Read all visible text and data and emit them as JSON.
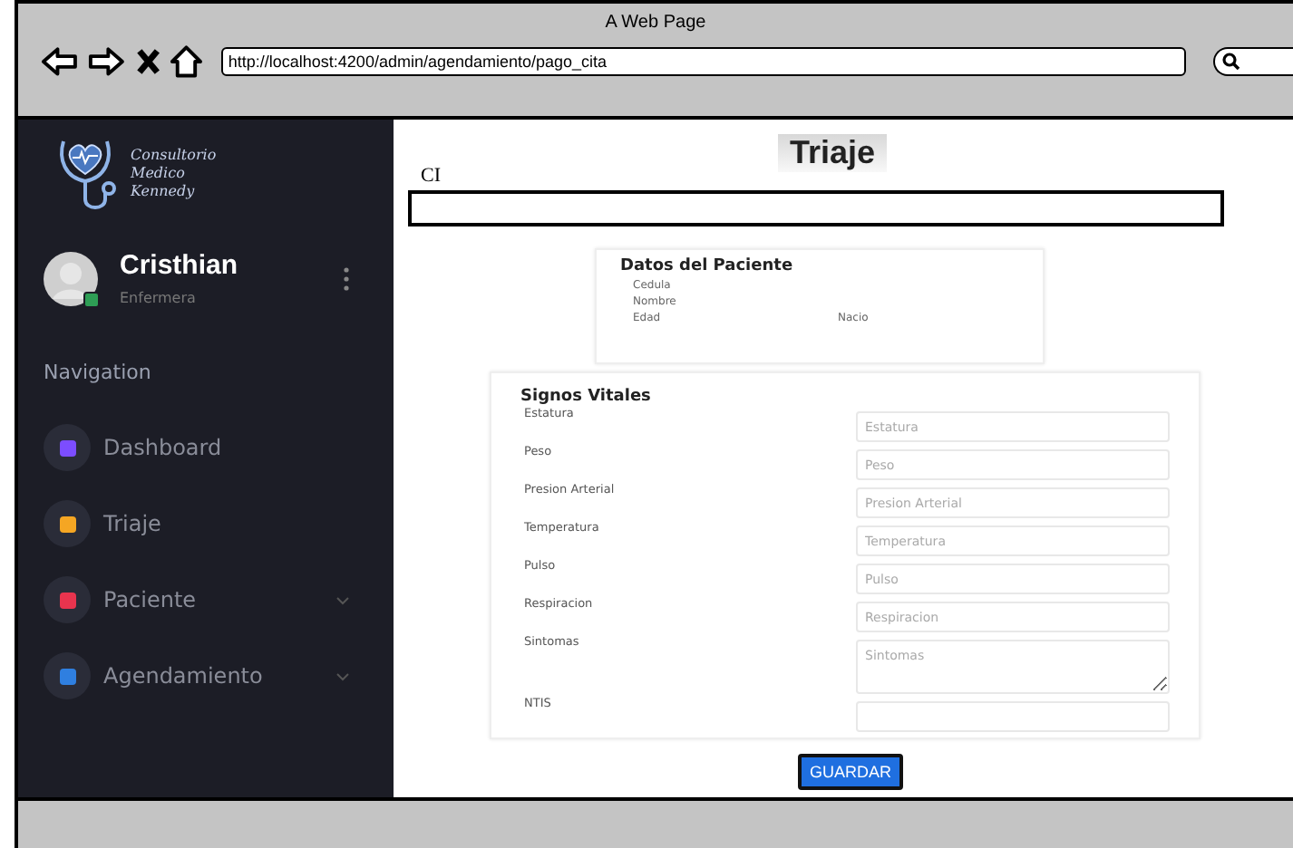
{
  "window": {
    "title": "A Web Page",
    "url": "http://localhost:4200/admin/agendamiento/pago_cita"
  },
  "sidebar": {
    "logo_lines": [
      "Consultorio",
      "Medico",
      "Kennedy"
    ],
    "user": {
      "name": "Cristhian",
      "role": "Enfermera",
      "online": true
    },
    "section": "Navigation",
    "items": [
      {
        "label": "Dashboard",
        "color": "#7c4dff",
        "has_submenu": false
      },
      {
        "label": "Triaje",
        "color": "#f5a623",
        "has_submenu": false
      },
      {
        "label": "Paciente",
        "color": "#e8344e",
        "has_submenu": true
      },
      {
        "label": "Agendamiento",
        "color": "#2f7fe0",
        "has_submenu": true
      }
    ]
  },
  "page": {
    "title": "Triaje",
    "ci_label": "CI",
    "patient": {
      "title": "Datos del Paciente",
      "fields": [
        [
          "Cedula"
        ],
        [
          "Nombre"
        ],
        [
          "Edad",
          "Nacio"
        ]
      ]
    },
    "vitals": {
      "title": "Signos Vitales",
      "rows": [
        {
          "label": "Estatura",
          "placeholder": "Estatura",
          "kind": "input"
        },
        {
          "label": "Peso",
          "placeholder": "Peso",
          "kind": "input"
        },
        {
          "label": "Presion Arterial",
          "placeholder": "Presion Arterial",
          "kind": "input"
        },
        {
          "label": "Temperatura",
          "placeholder": "Temperatura",
          "kind": "input"
        },
        {
          "label": "Pulso",
          "placeholder": "Pulso",
          "kind": "input"
        },
        {
          "label": "Respiracion",
          "placeholder": "Respiracion",
          "kind": "input"
        },
        {
          "label": "Sintomas",
          "placeholder": "Sintomas",
          "kind": "textarea"
        },
        {
          "label": "NTIS",
          "kind": "input"
        }
      ]
    },
    "save_button": "GUARDAR"
  }
}
